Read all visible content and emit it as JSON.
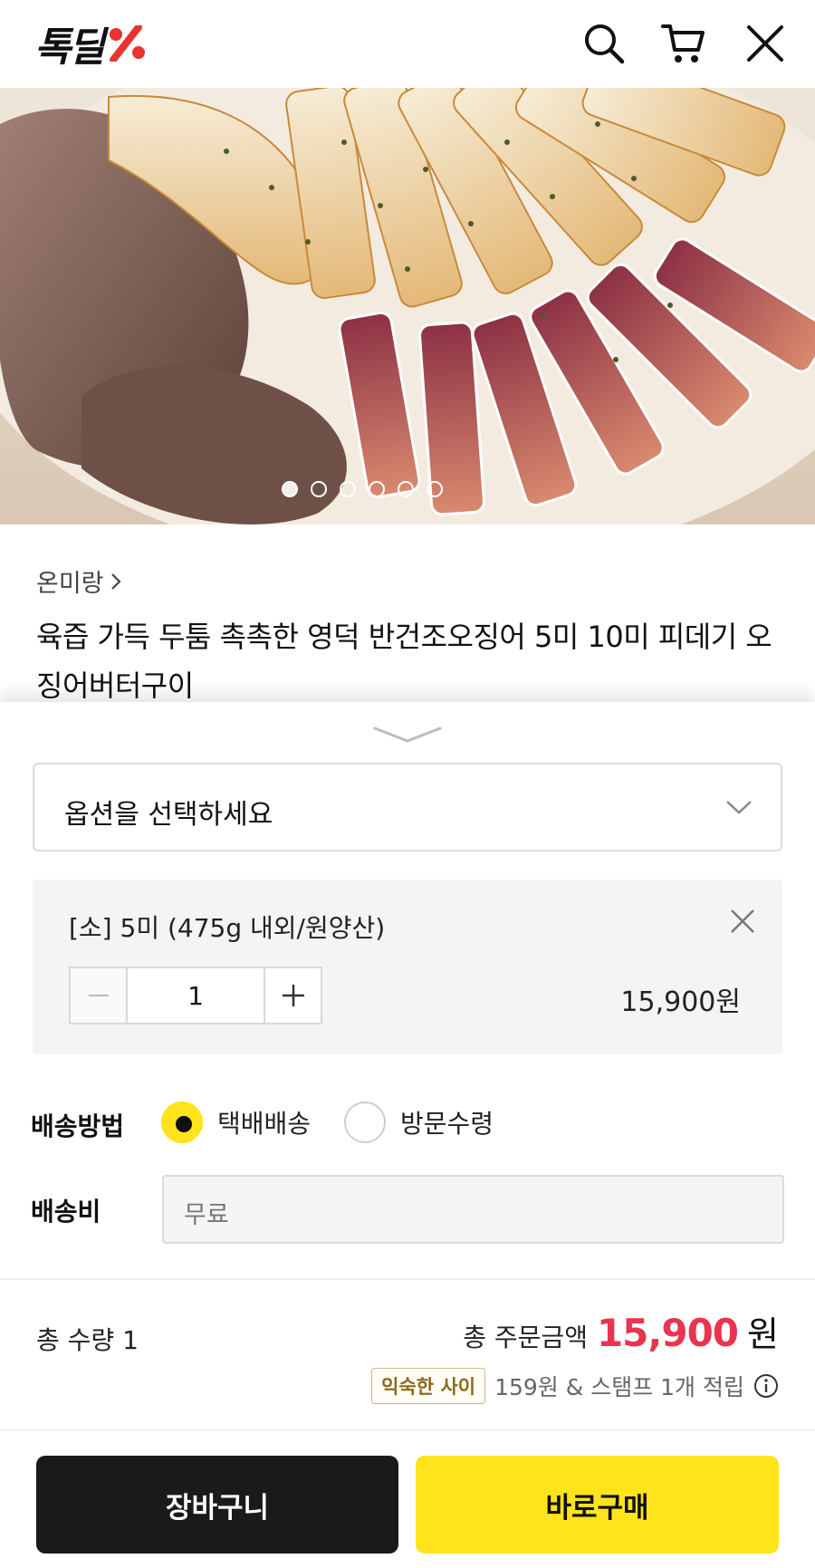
{
  "header": {
    "logo_text": "톡딜",
    "logo_mark": "%",
    "icons": [
      "search-icon",
      "cart-icon",
      "close-icon"
    ]
  },
  "gallery": {
    "slide_count": 6,
    "active_index": 0
  },
  "product": {
    "brand": "온미랑",
    "title": "육즙 가득 두툼 촉촉한 영덕 반건조오징어 5미 10미 피데기 오징어버터구이"
  },
  "option_select": {
    "placeholder": "옵션을 선택하세요"
  },
  "selected_option": {
    "name": "[소] 5미 (475g 내외/원양산)",
    "quantity": "1",
    "price": "15,900원"
  },
  "shipping": {
    "method_label": "배송방법",
    "methods": [
      "택배배송",
      "방문수령"
    ],
    "selected_method": "택배배송",
    "fee_label": "배송비",
    "fee_value": "무료"
  },
  "summary": {
    "qty_text": "총 수량  1",
    "total_label": "총 주문금액",
    "total_price": "15,900",
    "total_unit": "원",
    "reward_badge": "익숙한 사이",
    "reward_text": "159원 & 스탬프 1개 적립"
  },
  "actions": {
    "cart_label": "장바구니",
    "buy_label": "바로구매"
  },
  "colors": {
    "accent_yellow": "#ffe31b",
    "price_red": "#e8344e",
    "dark_button": "#1a1a1a"
  }
}
